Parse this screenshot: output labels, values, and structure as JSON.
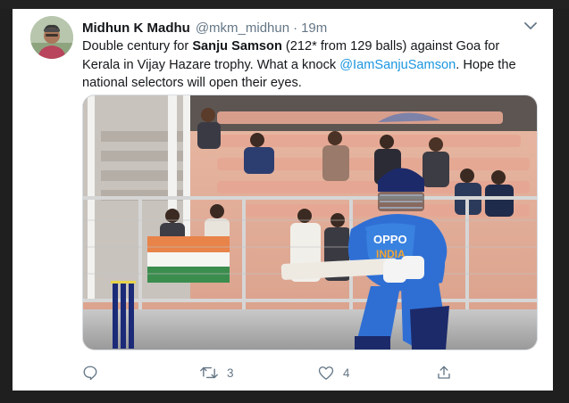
{
  "tweet": {
    "author_name": "Midhun K Madhu",
    "handle": "@mkm_midhun",
    "separator": "·",
    "time": "19m",
    "text": {
      "part1": "Double century for ",
      "bold1": "Sanju Samson",
      "part2": " (212* from 129 balls) against Goa for Kerala in Vijay Hazare trophy. What a knock ",
      "mention": "@IamSanjuSamson",
      "part3": ". Hope the national selectors will open their eyes."
    },
    "image": {
      "jersey_text": "INDIA",
      "sponsor_text": "OPPO"
    },
    "actions": {
      "reply_count": "",
      "retweet_count": "3",
      "like_count": "4"
    },
    "colors": {
      "link": "#1b95e0",
      "muted": "#657786",
      "text": "#14171a"
    },
    "icons": [
      "avatar",
      "chevron-down-icon",
      "reply-icon",
      "retweet-icon",
      "heart-icon",
      "share-icon"
    ]
  }
}
